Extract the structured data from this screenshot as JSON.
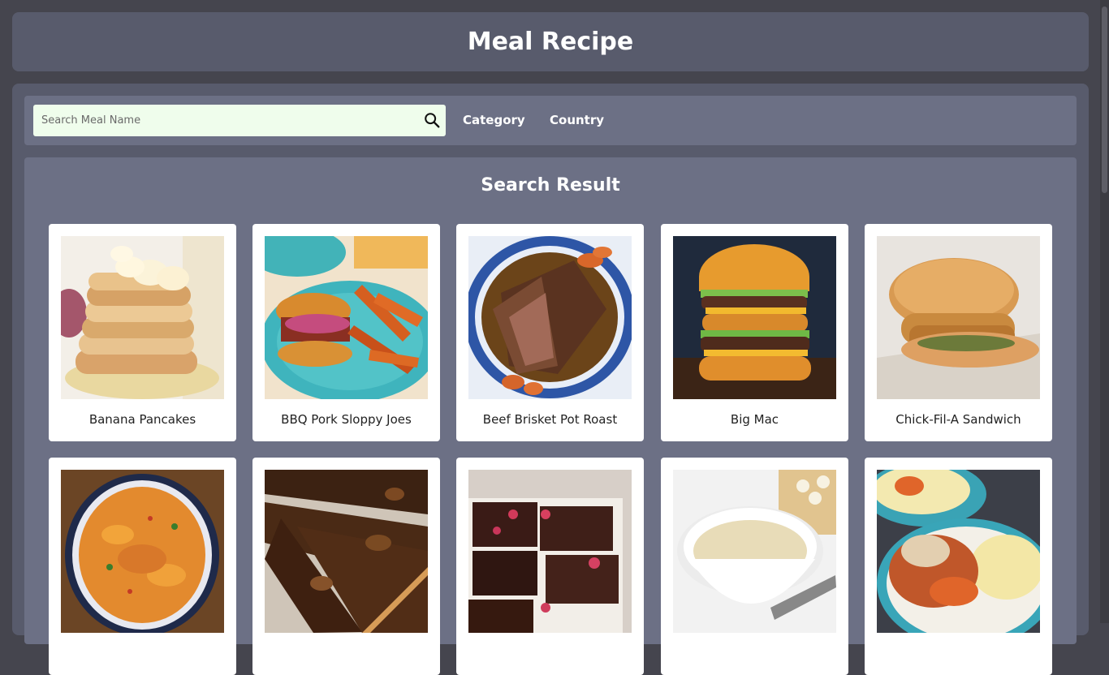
{
  "header": {
    "title": "Meal Recipe"
  },
  "search": {
    "placeholder": "Search Meal Name"
  },
  "nav": {
    "category": "Category",
    "country": "Country"
  },
  "results": {
    "title": "Search Result",
    "cards": [
      {
        "name": "Banana Pancakes"
      },
      {
        "name": "BBQ Pork Sloppy Joes"
      },
      {
        "name": "Beef Brisket Pot Roast"
      },
      {
        "name": "Big Mac"
      },
      {
        "name": "Chick-Fil-A Sandwich"
      },
      {
        "name": ""
      },
      {
        "name": ""
      },
      {
        "name": ""
      },
      {
        "name": ""
      },
      {
        "name": ""
      }
    ]
  }
}
